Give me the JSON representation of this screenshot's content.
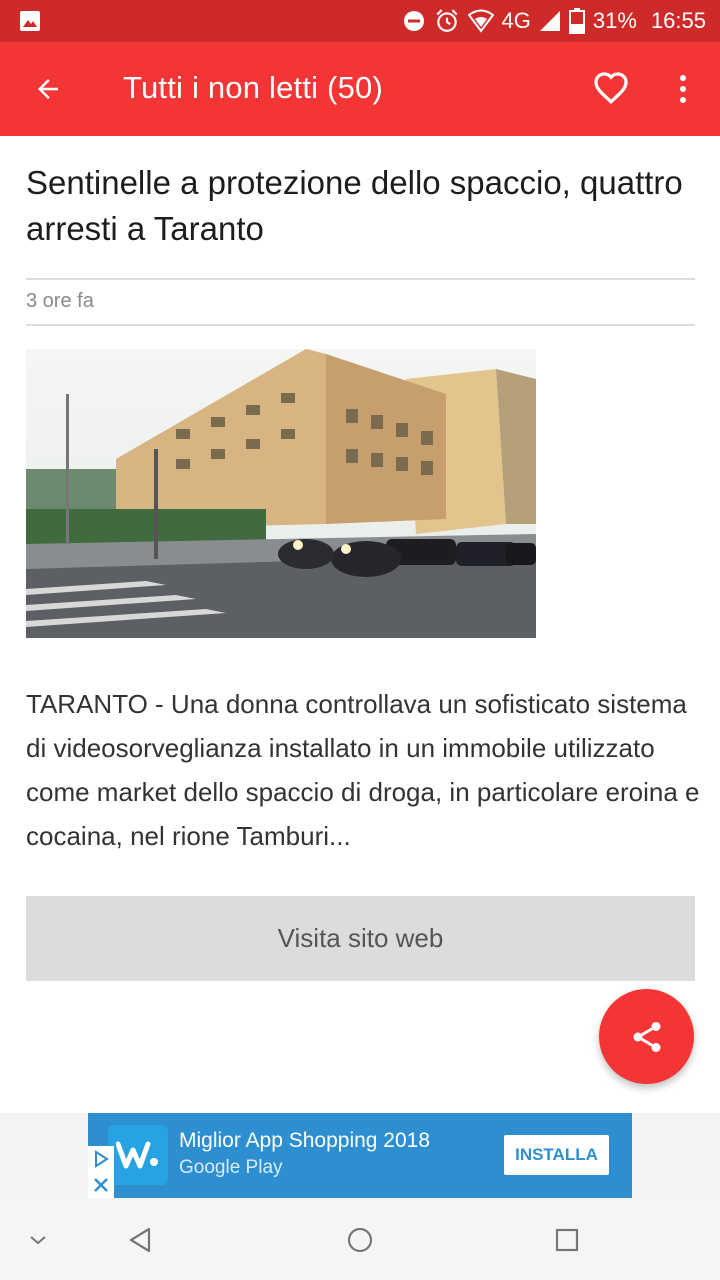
{
  "status_bar": {
    "network": "4G",
    "battery": "31%",
    "time": "16:55"
  },
  "app_bar": {
    "title": "Tutti i non letti (50)"
  },
  "article": {
    "title": "Sentinelle a protezione dello spaccio, quattro arresti a Taranto",
    "time_ago": "3 ore fa",
    "body": "TARANTO - Una donna controllava un sofisticato sistema di videosorveglianza installato in un immobile utilizzato come market dello spaccio di droga, in particolare eroina e cocaina, nel rione Tamburi...",
    "visit_label": "Visita sito web"
  },
  "ad": {
    "title": "Miglior App Shopping 2018",
    "subtitle": "Google Play",
    "install_label": "INSTALLA"
  },
  "colors": {
    "status_bar": "#cf2a2a",
    "app_bar": "#f43535",
    "fab": "#f43535",
    "ad_background": "#2d8fd0"
  },
  "icons": {
    "back": "arrow-back-icon",
    "favorite": "heart-icon",
    "more": "more-vert-icon",
    "share": "share-icon",
    "nav_down": "chevron-down-icon",
    "nav_back": "triangle-back-icon",
    "nav_home": "circle-home-icon",
    "nav_recents": "square-recents-icon"
  }
}
